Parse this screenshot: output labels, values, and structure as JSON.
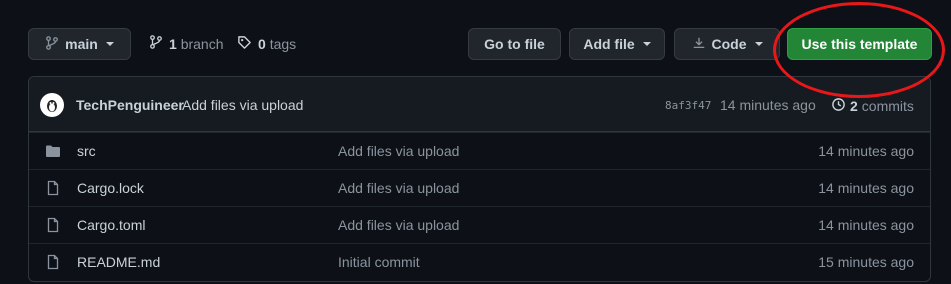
{
  "branch": {
    "current": "main",
    "count": "1",
    "branch_label": "branch"
  },
  "tags": {
    "count": "0",
    "label": "tags"
  },
  "actions": {
    "go_to_file": "Go to file",
    "add_file": "Add file",
    "code": "Code",
    "use_template": "Use this template"
  },
  "latest_commit": {
    "author": "TechPenguineer",
    "message": "Add files via upload",
    "sha": "8af3f47",
    "time": "14 minutes ago",
    "count": "2",
    "count_label": "commits"
  },
  "files": [
    {
      "name": "src",
      "type": "folder",
      "message": "Add files via upload",
      "age": "14 minutes ago"
    },
    {
      "name": "Cargo.lock",
      "type": "file",
      "message": "Add files via upload",
      "age": "14 minutes ago"
    },
    {
      "name": "Cargo.toml",
      "type": "file",
      "message": "Add files via upload",
      "age": "14 minutes ago"
    },
    {
      "name": "README.md",
      "type": "file",
      "message": "Initial commit",
      "age": "15 minutes ago"
    }
  ],
  "colors": {
    "accent_green": "#238636",
    "annotation_red": "#e8181a",
    "background": "#0d1117"
  },
  "icons": [
    "git-branch-icon",
    "tag-icon",
    "download-icon",
    "history-icon",
    "folder-icon",
    "file-icon"
  ]
}
